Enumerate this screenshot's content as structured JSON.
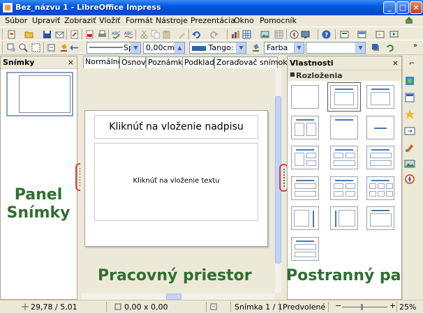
{
  "window": {
    "title": "Bez_názvu 1 - LibreOffice Impress",
    "buttons": {
      "minimize": "_",
      "maximize": "□",
      "close": "×"
    }
  },
  "menu": {
    "items": [
      "Súbor",
      "Upraviť",
      "Zobraziť",
      "Vložiť",
      "Formát",
      "Nástroje",
      "Prezentácia",
      "Okno",
      "Pomocník"
    ]
  },
  "toolbar2": {
    "line_style": "Sp",
    "line_width": "0,00cm",
    "line_color": "Tango: ne",
    "area_style": "Farba"
  },
  "slides_panel": {
    "title": "Snímky",
    "close": "×",
    "slide_number": "1"
  },
  "view_tabs": [
    "Normálne",
    "Osnova",
    "Poznámky",
    "Podklady",
    "Zoraďovač snímok"
  ],
  "slide": {
    "title_placeholder": "Kliknúť na vloženie nadpisu",
    "text_placeholder": "Kliknúť na vloženie textu"
  },
  "sidebar": {
    "title": "Vlastnosti",
    "close": "×",
    "section_title": "Rozloženia",
    "section_toggle": "■"
  },
  "annotations": {
    "slides_panel": "Panel\nSnímky",
    "workspace": "Pracovný priestor",
    "sidebar": "Postranný panel"
  },
  "status": {
    "position": "29,78 / 5,01",
    "size": "0,00 x 0,00",
    "slide_info": "Snímka 1 / 1",
    "master": "Predvolené",
    "zoom": "25%",
    "zoom_out": "−",
    "zoom_in": "+"
  },
  "colors": {
    "annotation_green": "#2e6f2e",
    "splitter_highlight": "#e04040"
  }
}
